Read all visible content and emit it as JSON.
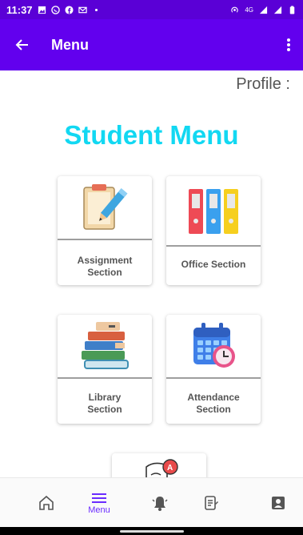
{
  "status_bar": {
    "time": "11:37",
    "signal_label": "4G",
    "left_icons": [
      "gallery-icon",
      "whatsapp-icon",
      "facebook-icon",
      "gmail-icon",
      "dot-icon"
    ],
    "right_icons": [
      "hotspot-icon",
      "signal-icon",
      "signal-icon",
      "battery-icon"
    ]
  },
  "app_bar": {
    "title": "Menu",
    "color": "#6200ee"
  },
  "profile_label": "Profile :",
  "page_title": "Student Menu",
  "title_color": "#12d8f2",
  "menu_items": [
    {
      "line1": "Assignment",
      "line2": "Section",
      "icon": "clipboard-pencil-icon"
    },
    {
      "line1": "Office Section",
      "line2": "",
      "icon": "binders-icon"
    },
    {
      "line1": "Library",
      "line2": "Section",
      "icon": "books-stack-icon"
    },
    {
      "line1": "Attendance",
      "line2": "Section",
      "icon": "calendar-clock-icon"
    },
    {
      "line1": "",
      "line2": "",
      "icon": "exam-grade-icon"
    }
  ],
  "bottom_nav": {
    "items": [
      {
        "icon": "home-icon",
        "label": ""
      },
      {
        "icon": "menu-icon",
        "label": "Menu",
        "active": true
      },
      {
        "icon": "notifications-icon",
        "label": ""
      },
      {
        "icon": "notes-icon",
        "label": ""
      },
      {
        "icon": "profile-card-icon",
        "label": ""
      }
    ],
    "active_color": "#6a2cff"
  }
}
